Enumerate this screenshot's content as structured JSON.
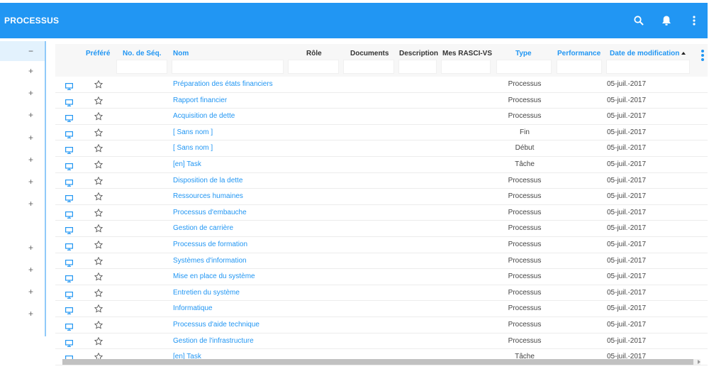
{
  "header": {
    "title": "PROCESSUS"
  },
  "sidebar": {
    "collapse_symbol": "−",
    "expand_symbol": "+"
  },
  "columns": {
    "prefere": "Préféré",
    "seq": "No. de Séq.",
    "nom": "Nom",
    "role": "Rôle",
    "documents": "Documents",
    "description": "Description",
    "rasci": "Mes RASCI-VS",
    "type": "Type",
    "performance": "Performance",
    "date": "Date de modification"
  },
  "colors": {
    "primary": "#2196f3",
    "rail": "#90caf9"
  },
  "rows": [
    {
      "name": "Préparation des états financiers",
      "type": "Processus",
      "date": "05-juil.-2017"
    },
    {
      "name": "Rapport financier",
      "type": "Processus",
      "date": "05-juil.-2017"
    },
    {
      "name": "Acquisition de dette",
      "type": "Processus",
      "date": "05-juil.-2017"
    },
    {
      "name": "[ Sans nom ]",
      "type": "Fin",
      "date": "05-juil.-2017"
    },
    {
      "name": "[ Sans nom ]",
      "type": "Début",
      "date": "05-juil.-2017"
    },
    {
      "name": "[en] Task",
      "type": "Tâche",
      "date": "05-juil.-2017"
    },
    {
      "name": "Disposition de la dette",
      "type": "Processus",
      "date": "05-juil.-2017"
    },
    {
      "name": "Ressources humaines",
      "type": "Processus",
      "date": "05-juil.-2017"
    },
    {
      "name": "Processus d'embauche",
      "type": "Processus",
      "date": "05-juil.-2017"
    },
    {
      "name": "Gestion de carrière",
      "type": "Processus",
      "date": "05-juil.-2017"
    },
    {
      "name": "Processus de formation",
      "type": "Processus",
      "date": "05-juil.-2017"
    },
    {
      "name": "Systèmes d'information",
      "type": "Processus",
      "date": "05-juil.-2017"
    },
    {
      "name": "Mise en place du système",
      "type": "Processus",
      "date": "05-juil.-2017"
    },
    {
      "name": "Entretien du système",
      "type": "Processus",
      "date": "05-juil.-2017"
    },
    {
      "name": "Informatique",
      "type": "Processus",
      "date": "05-juil.-2017"
    },
    {
      "name": "Processus d'aide technique",
      "type": "Processus",
      "date": "05-juil.-2017"
    },
    {
      "name": "Gestion de l'infrastructure",
      "type": "Processus",
      "date": "05-juil.-2017"
    },
    {
      "name": "[en] Task",
      "type": "Tâche",
      "date": "05-juil.-2017"
    }
  ]
}
